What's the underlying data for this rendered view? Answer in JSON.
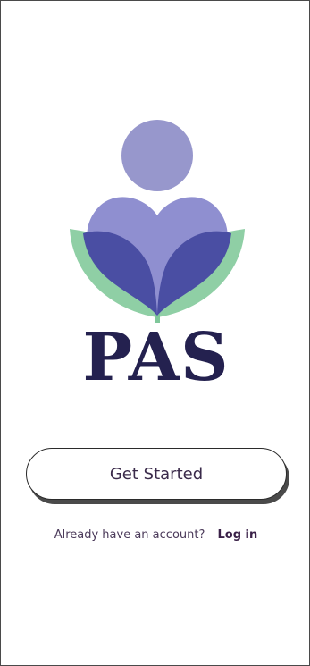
{
  "brand": {
    "name": "PAS"
  },
  "colors": {
    "head": "#9797cc",
    "heart_light": "#8f8fd0",
    "heart_dark": "#4a4ea3",
    "leaves": "#8fcfa5",
    "stem": "#7fc79a",
    "wordmark": "#24214f"
  },
  "actions": {
    "get_started_label": "Get Started"
  },
  "login": {
    "prompt": "Already have an account?",
    "link_label": "Log in"
  }
}
